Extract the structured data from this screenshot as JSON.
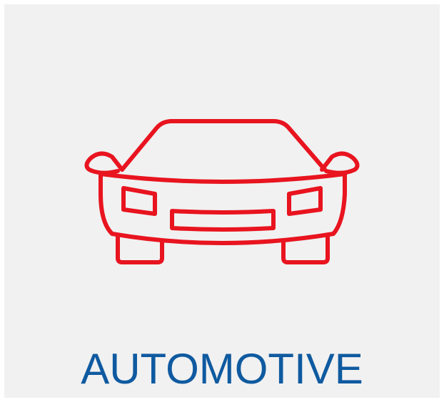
{
  "tile": {
    "label": "AUTOMOTIVE",
    "icon": "car-front-icon"
  },
  "colors": {
    "background": "#f1f1f1",
    "icon": "#e8141f",
    "label": "#0f5aa0"
  }
}
